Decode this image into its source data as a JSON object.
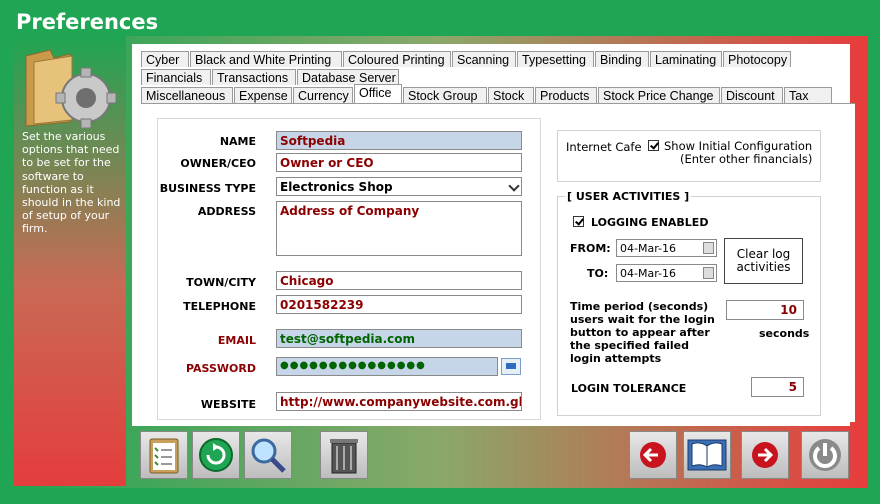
{
  "window": {
    "title": "Preferences"
  },
  "sidebar": {
    "description": "Set the various options that need to be set for the software to function as it should in the kind of setup of your firm."
  },
  "tabs": {
    "row1": [
      "Cyber",
      "Black and White Printing",
      "Coloured Printing",
      "Scanning",
      "Typesetting",
      "Binding",
      "Laminating",
      "Photocopy"
    ],
    "row2": [
      "Financials",
      "Transactions",
      "Database Server"
    ],
    "row3": [
      "Miscellaneous",
      "Expense",
      "Currency",
      "Office",
      "Stock Group",
      "Stock",
      "Products",
      "Stock Price Change",
      "Discount",
      "Tax"
    ],
    "active": "Office"
  },
  "form": {
    "name_label": "NAME",
    "name_value": "Softpedia",
    "owner_label": "OWNER/CEO",
    "owner_value": "Owner or CEO",
    "business_type_label": "BUSINESS TYPE",
    "business_type_value": "Electronics Shop",
    "address_label": "ADDRESS",
    "address_value": "Address of Company",
    "town_label": "TOWN/CITY",
    "town_value": "Chicago",
    "telephone_label": "TELEPHONE",
    "telephone_value": "0201582239",
    "email_label": "EMAIL",
    "email_value": "test@softpedia.com",
    "password_label": "PASSWORD",
    "password_value": "●●●●●●●●●●●●●●●",
    "website_label": "WEBSITE",
    "website_value": "http://www.companywebsite.com.gh"
  },
  "settings": {
    "internet_cafe_label": "Internet Cafe",
    "show_initial_label": "Show Initial Configuration",
    "show_initial_sub": "(Enter other financials)",
    "user_activities_title": "[ USER ACTIVITIES ]",
    "logging_label": "LOGGING ENABLED",
    "from_label": "FROM:",
    "from_value": "04-Mar-16",
    "to_label": "TO:",
    "to_value": "04-Mar-16",
    "clear_log_label": "Clear log activities",
    "time_period_label": "Time period (seconds) users wait for the login button to appear after the specified failed login attempts",
    "time_period_value": "10",
    "seconds_label": "seconds",
    "login_tolerance_label": "LOGIN TOLERANCE",
    "login_tolerance_value": "5"
  },
  "colors": {
    "accent_green": "#1fa553",
    "accent_red": "#e43d3d",
    "input_highlight": "#c6d5e8"
  }
}
